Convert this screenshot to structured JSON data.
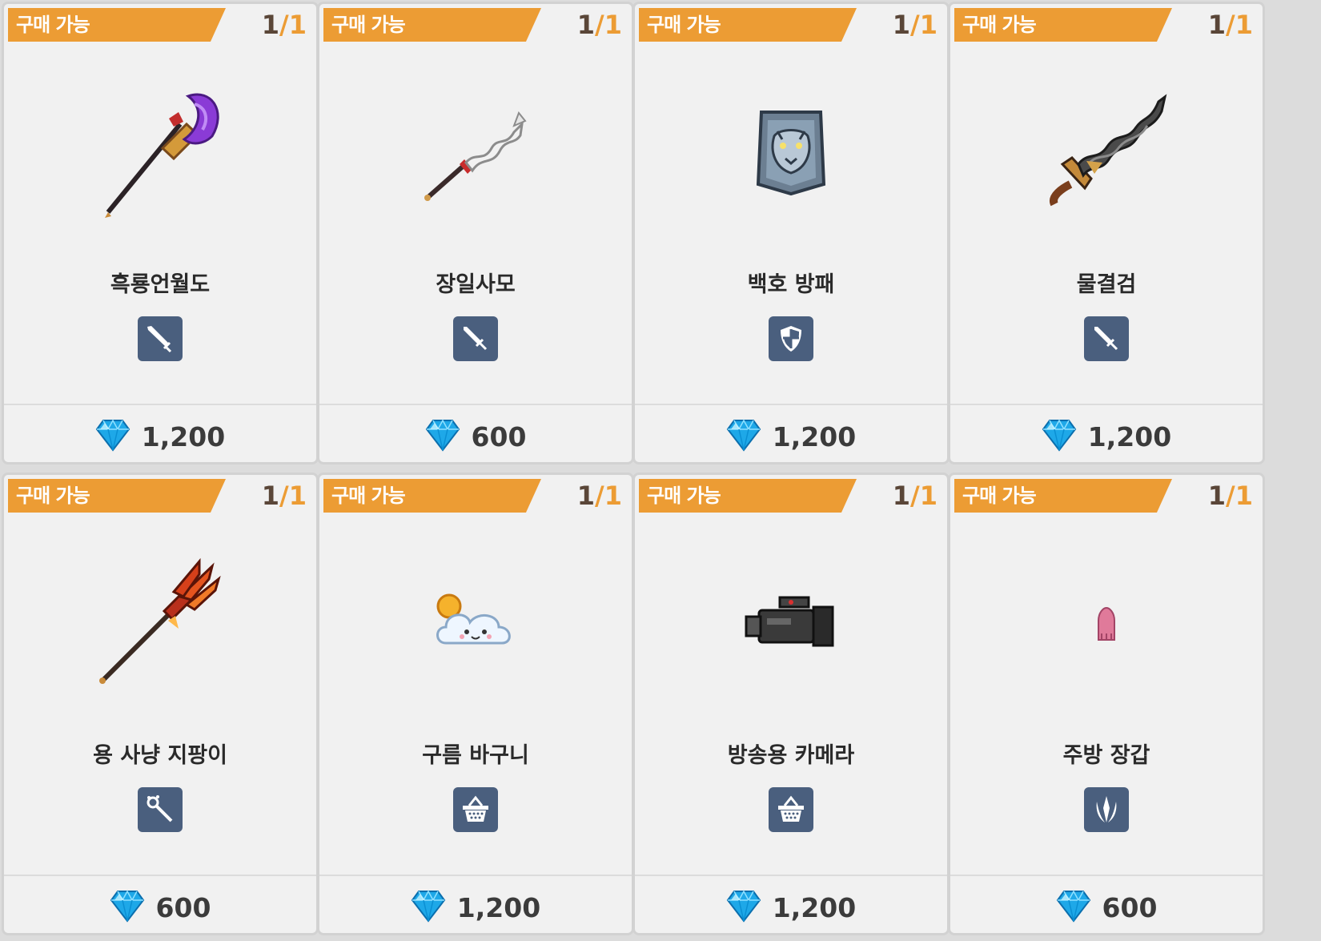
{
  "colors": {
    "badge": "#ec9c34",
    "count_owned": "#5a4638",
    "count_max": "#ec9c34",
    "type_icon_bg": "#4a5f7e",
    "card_bg": "#f1f1f1"
  },
  "items": [
    {
      "badge": "구매 가능",
      "owned": "1",
      "slash": "/",
      "max": "1",
      "name": "흑룡언월도",
      "type_icon": "greatsword-icon",
      "currency_icon": "blue-gem-icon",
      "price": "1,200",
      "art": "halberd"
    },
    {
      "badge": "구매 가능",
      "owned": "1",
      "slash": "/",
      "max": "1",
      "name": "장일사모",
      "type_icon": "sword-icon",
      "currency_icon": "blue-gem-icon",
      "price": "600",
      "art": "wavy-spear"
    },
    {
      "badge": "구매 가능",
      "owned": "1",
      "slash": "/",
      "max": "1",
      "name": "백호 방패",
      "type_icon": "shield-icon",
      "currency_icon": "blue-gem-icon",
      "price": "1,200",
      "art": "tiger-shield"
    },
    {
      "badge": "구매 가능",
      "owned": "1",
      "slash": "/",
      "max": "1",
      "name": "물결검",
      "type_icon": "sword-icon",
      "currency_icon": "blue-gem-icon",
      "price": "1,200",
      "art": "wave-sword"
    },
    {
      "badge": "구매 가능",
      "owned": "1",
      "slash": "/",
      "max": "1",
      "name": "용 사냥 지팡이",
      "type_icon": "staff-icon",
      "currency_icon": "blue-gem-icon",
      "price": "600",
      "art": "fire-trident"
    },
    {
      "badge": "구매 가능",
      "owned": "1",
      "slash": "/",
      "max": "1",
      "name": "구름 바구니",
      "type_icon": "basket-icon",
      "currency_icon": "blue-gem-icon",
      "price": "1,200",
      "art": "cloud"
    },
    {
      "badge": "구매 가능",
      "owned": "1",
      "slash": "/",
      "max": "1",
      "name": "방송용 카메라",
      "type_icon": "basket-icon",
      "currency_icon": "blue-gem-icon",
      "price": "1,200",
      "art": "camera"
    },
    {
      "badge": "구매 가능",
      "owned": "1",
      "slash": "/",
      "max": "1",
      "name": "주방 장갑",
      "type_icon": "claw-icon",
      "currency_icon": "blue-gem-icon",
      "price": "600",
      "art": "glove"
    }
  ]
}
